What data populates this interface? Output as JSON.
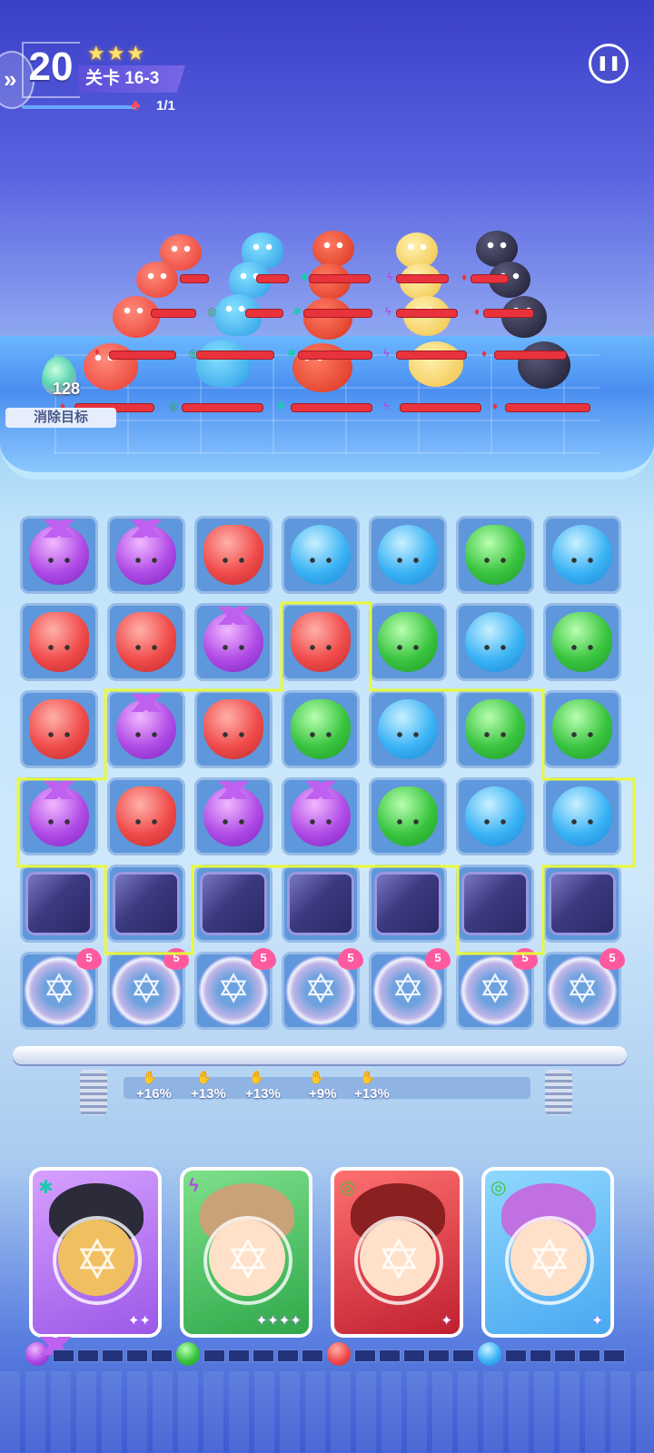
{
  "hud": {
    "moves_left": "20",
    "stars": "★★★",
    "level": "关卡 16-3",
    "target_count": "1/1",
    "pause_icon": "pause-icon"
  },
  "arena": {
    "player_drop_value": "128",
    "clear_target_label": "消除目标"
  },
  "board": {
    "rows": [
      [
        "purple",
        "purple",
        "red",
        "blue",
        "blue",
        "green",
        "blue"
      ],
      [
        "red",
        "red",
        "purple",
        "red",
        "green",
        "blue",
        "green"
      ],
      [
        "red",
        "purple",
        "red",
        "green",
        "blue",
        "green",
        "green"
      ],
      [
        "purple",
        "red",
        "purple",
        "purple",
        "green",
        "blue",
        "blue"
      ],
      [
        "box",
        "box",
        "box",
        "box",
        "box",
        "box",
        "box"
      ],
      [
        "magic",
        "magic",
        "magic",
        "magic",
        "magic",
        "magic",
        "magic"
      ]
    ],
    "magic_count": "5"
  },
  "bonuses": [
    "+16%",
    "+13%",
    "+13%",
    "+9%",
    "+13%"
  ],
  "heroes": [
    {
      "name": "hero-1",
      "element": "✱",
      "element_color": "#1fc8b0",
      "stars": "✦✦"
    },
    {
      "name": "hero-2",
      "element": "ϟ",
      "element_color": "#b04be6",
      "stars": "✦✦✦✦"
    },
    {
      "name": "hero-3",
      "element": "◎",
      "element_color": "#39c43f",
      "stars": "✦"
    },
    {
      "name": "hero-4",
      "element": "◎",
      "element_color": "#39c43f",
      "stars": "✦"
    }
  ],
  "colors": {
    "purple": "#b04be6",
    "red": "#f04b4b",
    "blue": "#3bb3f5",
    "green": "#39c43f",
    "highlight": "#e8f93a"
  }
}
